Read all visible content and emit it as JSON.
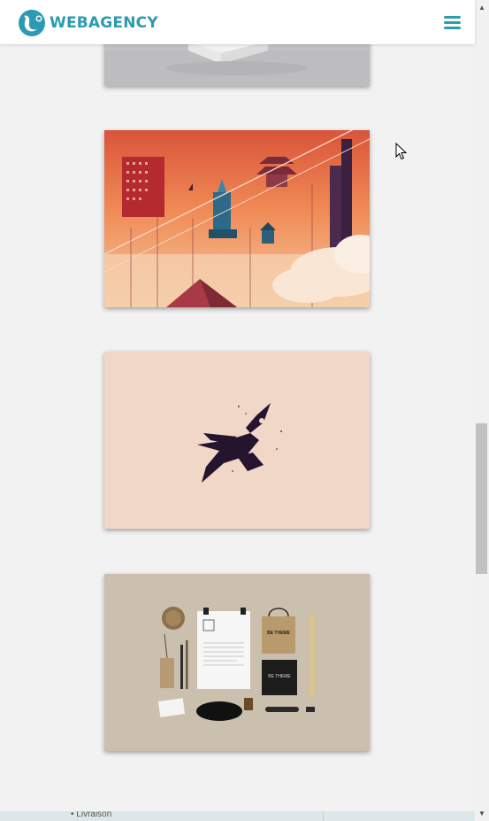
{
  "header": {
    "brand_name": "WEBAGENCY",
    "brand_color": "#2a9bb0",
    "menu_icon": "hamburger-icon",
    "menu_color": "#2a9bb0"
  },
  "portfolio": {
    "items": [
      {
        "image": "white-box-mockup",
        "background": "#c2c2c4"
      },
      {
        "image": "sunset-city-illustration",
        "background": "#e8754a"
      },
      {
        "image": "rocket-logo",
        "background": "#f0d7c7"
      },
      {
        "image": "stationery-branding-mockup",
        "background": "#cbbfad"
      }
    ]
  },
  "mockup": {
    "bag_title": "BE THEME",
    "card_title": "BE THEME"
  },
  "map": {
    "label": "• Livraison"
  }
}
